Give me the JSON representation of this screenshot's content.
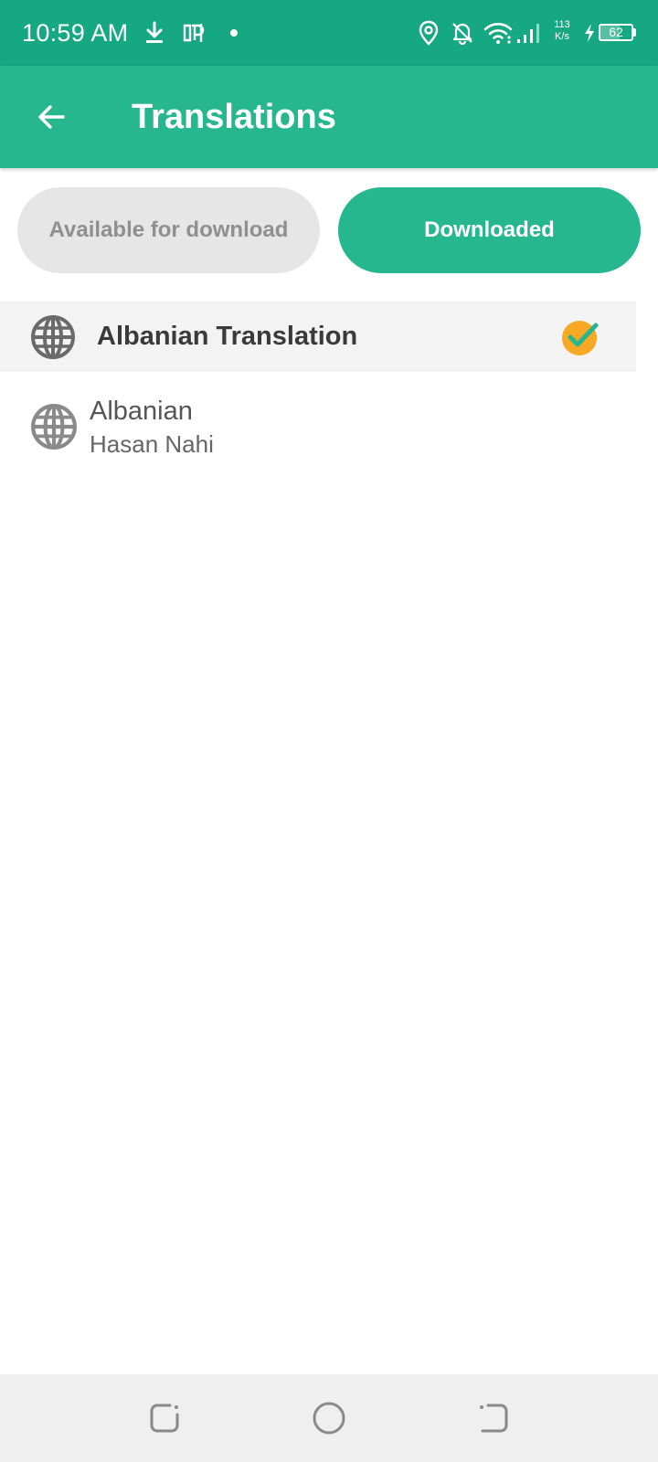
{
  "status_bar": {
    "time": "10:59 AM",
    "net_speed_value": "113",
    "net_speed_unit": "K/s",
    "battery_level": "62",
    "battery_fraction": 0.62,
    "icons": [
      "download-icon",
      "parking-icon",
      "notification-dot-icon",
      "location-icon",
      "bell-off-icon",
      "wifi-icon",
      "signal-icon",
      "charging-icon",
      "battery-icon"
    ]
  },
  "app_bar": {
    "title": "Translations",
    "back_icon": "arrow-left-icon"
  },
  "tabs": [
    {
      "label": "Available for download",
      "selected": false
    },
    {
      "label": "Downloaded",
      "selected": true
    }
  ],
  "group": {
    "title": "Albanian Translation",
    "icon": "globe-icon",
    "status_icon": "check-badge-icon"
  },
  "items": [
    {
      "title": "Albanian",
      "subtitle": "Hasan Nahi",
      "icon": "globe-icon"
    }
  ],
  "nav_bar": {
    "buttons": [
      "recent-apps-icon",
      "home-icon",
      "back-nav-icon"
    ]
  },
  "colors": {
    "status_bar": "#16a882",
    "accent": "#26b78e",
    "tab_inactive_bg": "#e6e6e6",
    "tab_inactive_text": "#8f8f8f",
    "badge_orange": "#f7a824",
    "group_header_bg": "#f3f3f3",
    "nav_bar_bg": "#efefef"
  }
}
